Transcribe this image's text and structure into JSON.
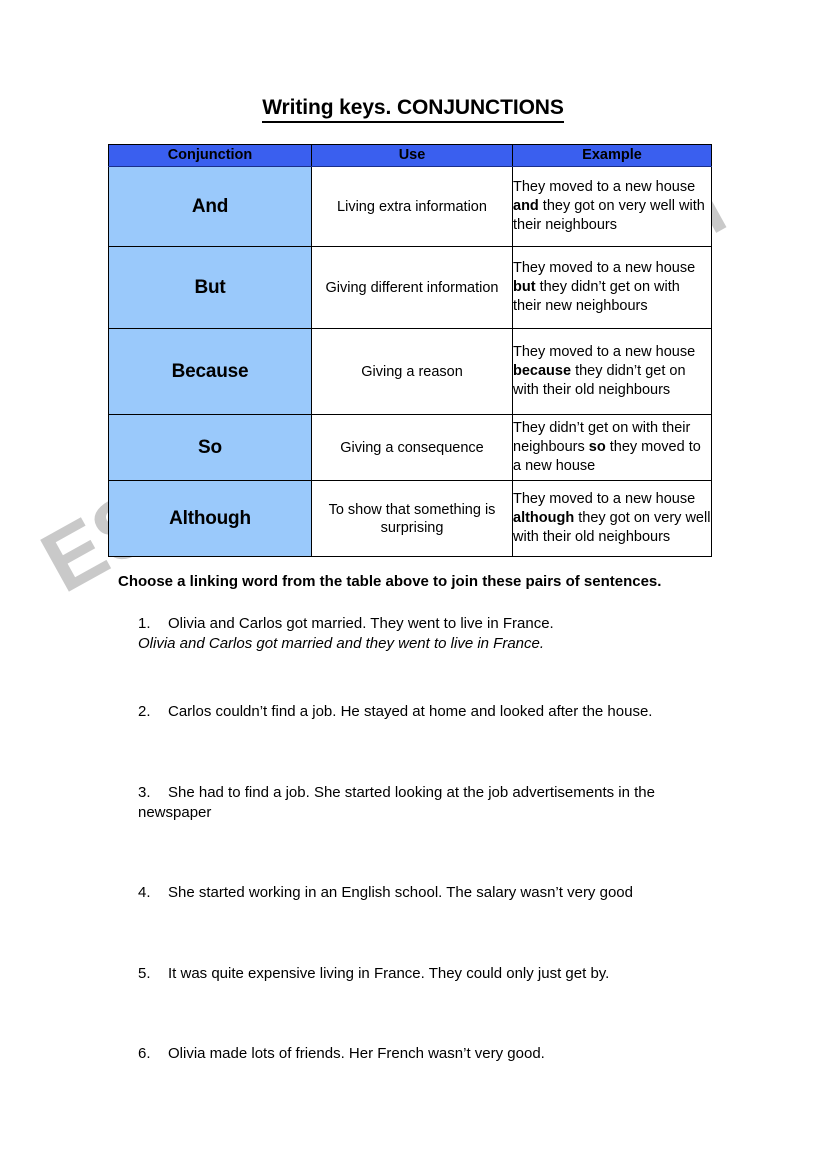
{
  "document": {
    "title": "Writing keys. CONJUNCTIONS",
    "watermark": "ESLprintables.com"
  },
  "table": {
    "headers": {
      "conjunction": "Conjunction",
      "use": "Use",
      "example": "Example"
    },
    "header_bg": "#3A5FEF",
    "conjunction_cell_bg": "#9AC9FB",
    "rows": [
      {
        "conjunction": "And",
        "use": "Living extra information",
        "example_before": "They moved to a new house ",
        "example_bold": "and",
        "example_after": " they got on very well with their neighbours"
      },
      {
        "conjunction": "But",
        "use": "Giving different information",
        "example_before": "They moved to a new house ",
        "example_bold": "but",
        "example_after": " they didn’t get on with their new neighbours"
      },
      {
        "conjunction": "Because",
        "use": "Giving a reason",
        "example_before": "They moved to a new house ",
        "example_bold": "because",
        "example_after": " they didn’t get on with their old neighbours"
      },
      {
        "conjunction": "So",
        "use": "Giving a consequence",
        "example_before": "They didn’t get on with their neighbours ",
        "example_bold": "so",
        "example_after": " they moved to a new house"
      },
      {
        "conjunction": "Although",
        "use": "To show that something is surprising",
        "example_before": "They moved to a new house ",
        "example_bold": "although",
        "example_after": " they got on very well with their old neighbours"
      }
    ]
  },
  "exercise": {
    "instruction": "Choose a linking word from the table above to join these pairs of sentences.",
    "items": [
      {
        "number": "1.",
        "text": "Olivia and Carlos got married. They went to live in France.",
        "answer": "Olivia and Carlos got married and they went to live in France."
      },
      {
        "number": "2.",
        "text": "Carlos couldn’t find a job. He stayed at home and looked after the house.",
        "answer": ""
      },
      {
        "number": "3.",
        "text": "She had to find a job. She started looking at the job advertisements in the newspaper",
        "answer": ""
      },
      {
        "number": "4.",
        "text": "She started working in an English school. The salary wasn’t very good",
        "answer": ""
      },
      {
        "number": "5.",
        "text": "It was quite expensive living in France. They could only just get by.",
        "answer": ""
      },
      {
        "number": "6.",
        "text": "Olivia made lots of friends. Her French wasn’t very good.",
        "answer": ""
      }
    ]
  }
}
